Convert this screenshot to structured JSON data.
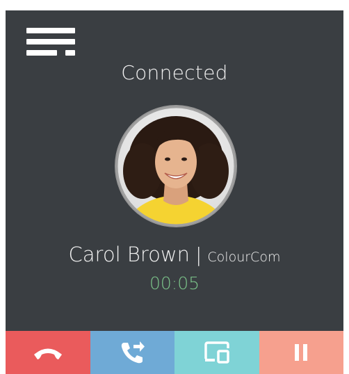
{
  "call": {
    "status": "Connected",
    "caller_name": "Carol Brown",
    "separator": "|",
    "company": "ColourCom",
    "duration": "00:05"
  },
  "icons": {
    "menu": "menu-lines-icon",
    "hangup": "phone-hangup-icon",
    "transfer": "phone-transfer-icon",
    "screen_share": "screen-share-icon",
    "hold": "pause-icon"
  },
  "colors": {
    "background": "#3a3e42",
    "status_text": "#f2f2f2",
    "timer": "#7cc48a",
    "hangup_button": "#ea5b5c",
    "transfer_button": "#6faad6",
    "screen_share_button": "#7fd3d6",
    "hold_button": "#f6a08e"
  }
}
